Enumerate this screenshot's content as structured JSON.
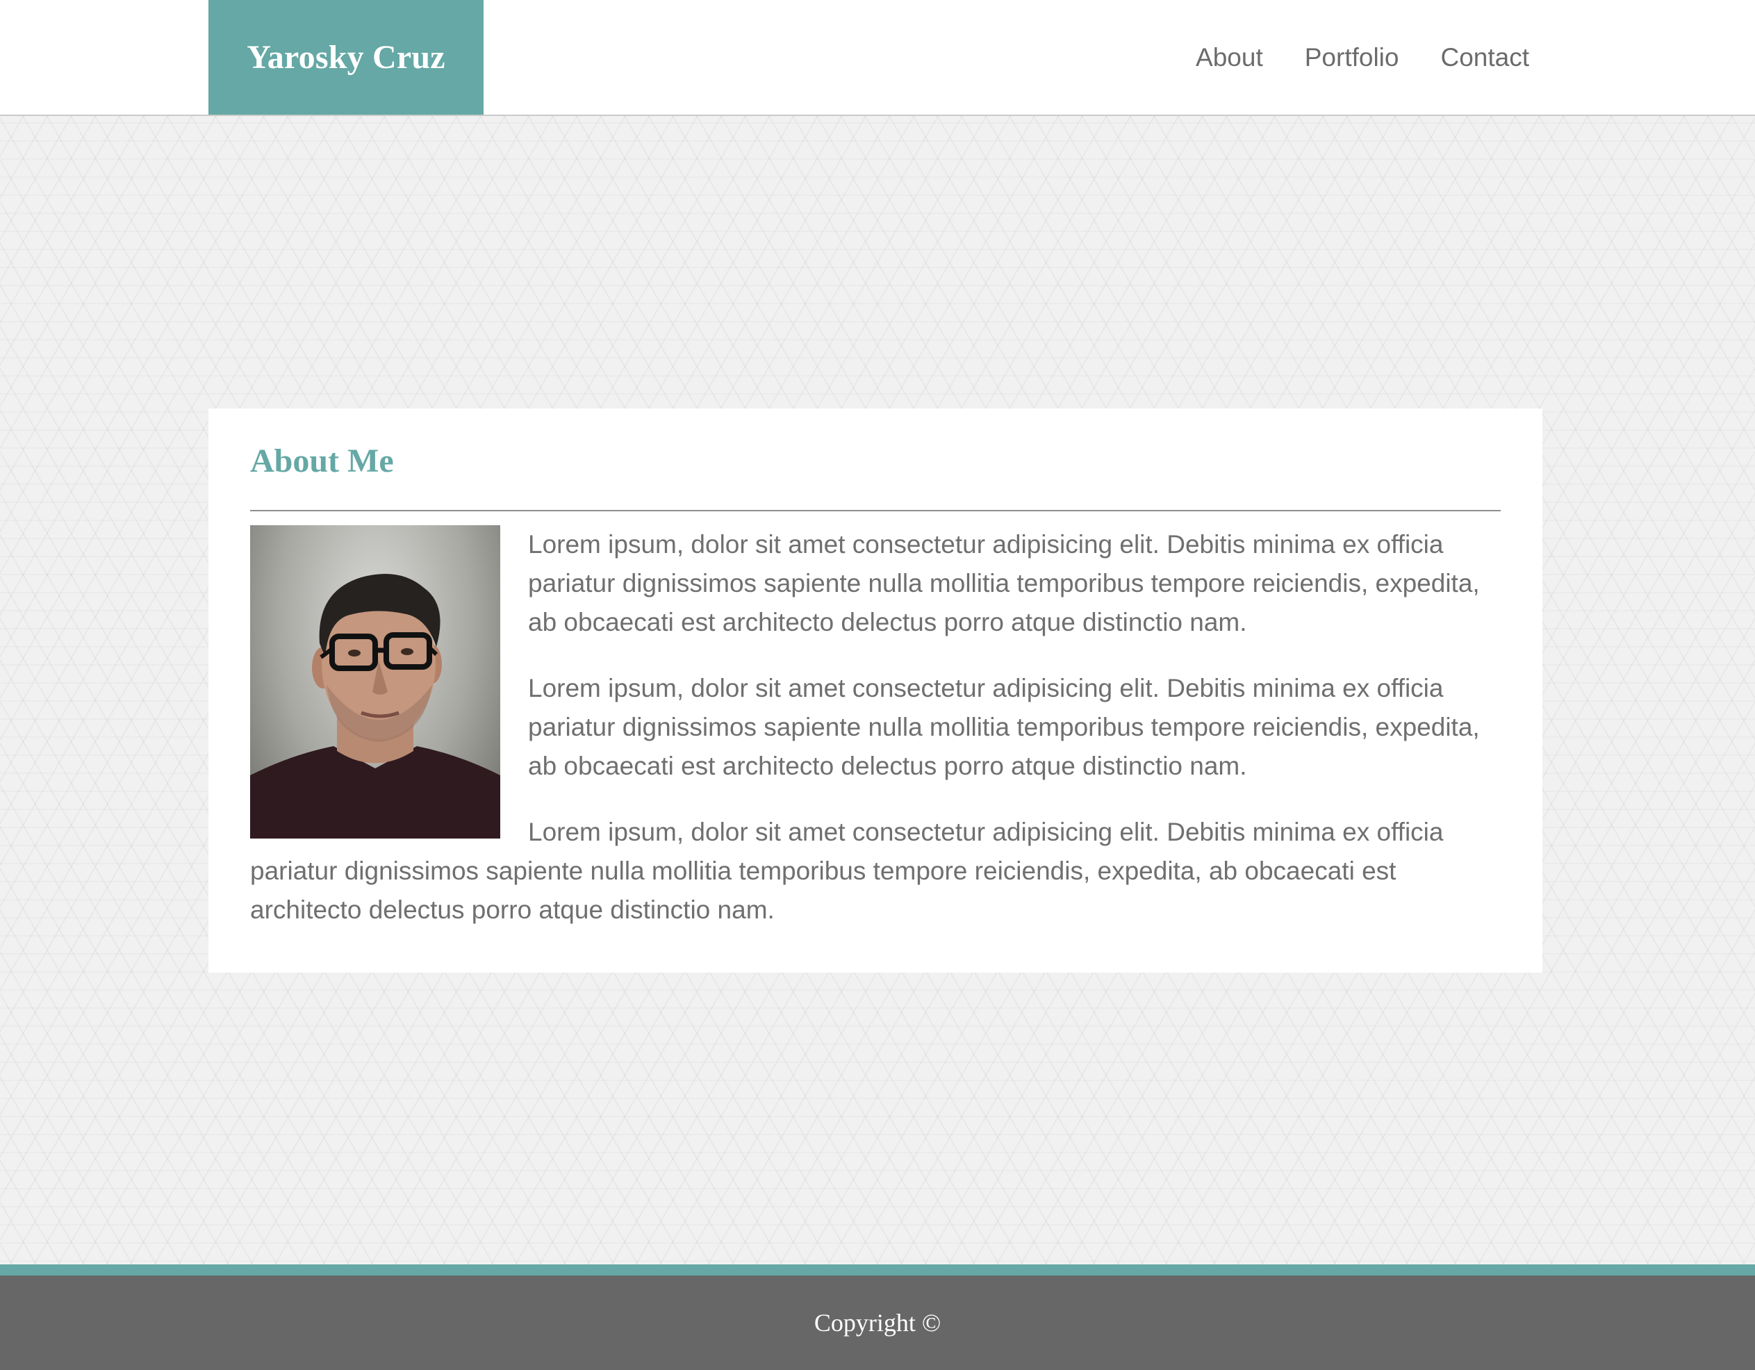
{
  "header": {
    "brand": "Yarosky Cruz",
    "nav": [
      {
        "label": "About"
      },
      {
        "label": "Portfolio"
      },
      {
        "label": "Contact"
      }
    ]
  },
  "about": {
    "title": "About Me",
    "paragraphs": [
      "Lorem ipsum, dolor sit amet consectetur adipisicing elit. Debitis minima ex officia pariatur dignissimos sapiente nulla mollitia temporibus tempore reiciendis, expedita, ab obcaecati est architecto delectus porro atque distinctio nam.",
      "Lorem ipsum, dolor sit amet consectetur adipisicing elit. Debitis minima ex officia pariatur dignissimos sapiente nulla mollitia temporibus tempore reiciendis, expedita, ab obcaecati est architecto delectus porro atque distinctio nam.",
      "Lorem ipsum, dolor sit amet consectetur adipisicing elit. Debitis minima ex officia pariatur dignissimos sapiente nulla mollitia temporibus tempore reiciendis, expedita, ab obcaecati est architecto delectus porro atque distinctio nam."
    ]
  },
  "footer": {
    "copyright": "Copyright ©"
  },
  "colors": {
    "accent": "#65a8a5",
    "footer_bg": "#676767",
    "text": "#6f6f6f"
  }
}
